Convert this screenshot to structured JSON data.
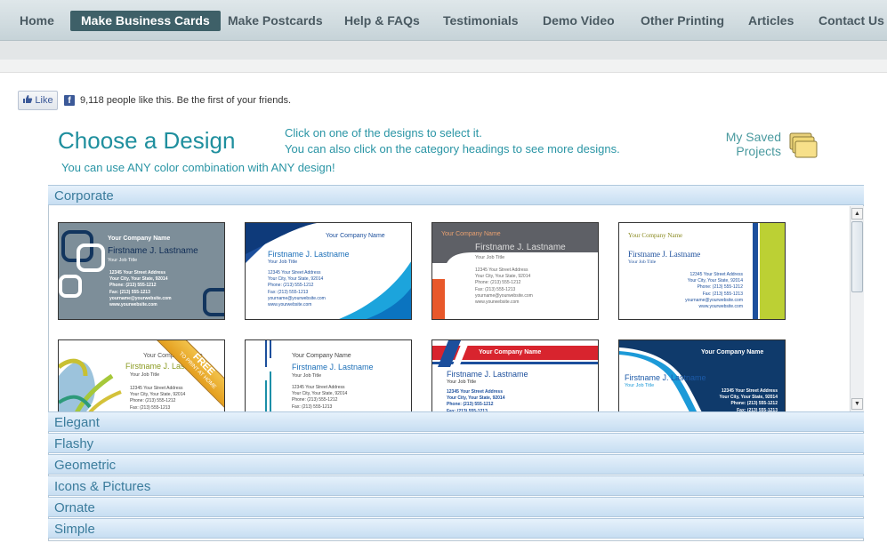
{
  "nav": {
    "items": [
      {
        "label": "Home"
      },
      {
        "label": "Make Business Cards",
        "active": true
      },
      {
        "label": "Make Postcards"
      },
      {
        "label": "Help & FAQs"
      },
      {
        "label": "Testimonials"
      },
      {
        "label": "Demo Video"
      },
      {
        "label": "Other Printing"
      },
      {
        "label": "Articles"
      },
      {
        "label": "Contact Us"
      }
    ]
  },
  "social": {
    "like_label": "Like",
    "fb_glyph": "f",
    "like_text": "9,118 people like this. Be the first of your friends."
  },
  "header": {
    "title": "Choose a Design",
    "subtitle": "You can use ANY color combination with ANY design!",
    "instruction_1": "Click on one of the designs to select it.",
    "instruction_2": "You can also click on the category headings to see more designs.",
    "saved_projects": "My Saved Projects"
  },
  "categories": {
    "active": "Corporate",
    "others": [
      "Elegant",
      "Flashy",
      "Geometric",
      "Icons & Pictures",
      "Ornate",
      "Simple"
    ]
  },
  "card_text": {
    "company": "Your Company Name",
    "name": "Firstname J. Lastname",
    "job": "Your Job Title",
    "street": "12345 Your Street Address",
    "city": "Your City, Your State, 92014",
    "phone": "Phone: (213) 555-1212",
    "fax": "Fax: (213) 555-1213",
    "email": "yourname@yourwebsite.com",
    "web": "www.yourwebsite.com"
  },
  "free_ribbon": {
    "line1": "FREE",
    "line2": "TO PRINT AT HOME"
  },
  "colors": {
    "nav_active": "#3e6068",
    "title": "#1f8f9e",
    "category_text": "#3b7c9c",
    "card_blue": "#1c5aa8",
    "card_navy": "#0f3a6b"
  },
  "icons": [
    "thumbs-up-icon",
    "facebook-icon",
    "folder-stack-icon",
    "scroll-up-icon",
    "scroll-down-icon"
  ]
}
